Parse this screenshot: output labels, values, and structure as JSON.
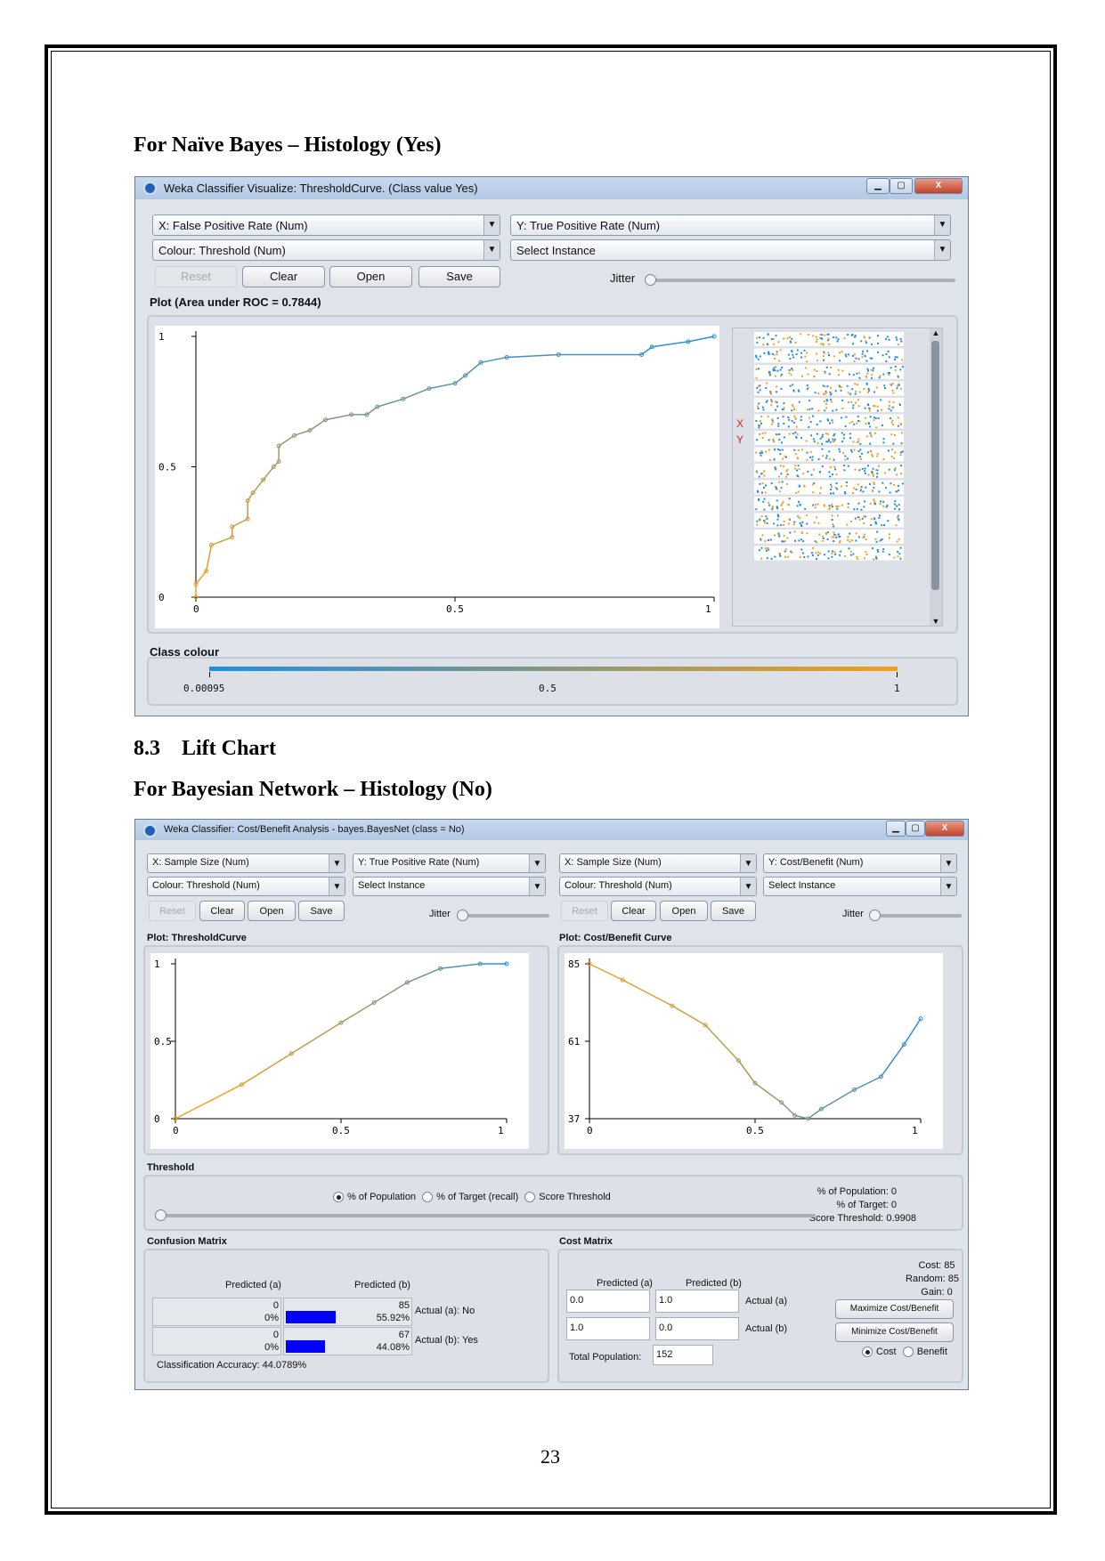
{
  "headings": {
    "h1": "For Naïve Bayes – Histology (Yes)",
    "section_num": "8.3",
    "section_title": "Lift Chart",
    "h2": "For Bayesian Network – Histology (No)"
  },
  "page_number": "23",
  "window1": {
    "title": "Weka Classifier Visualize: ThresholdCurve. (Class value Yes)",
    "x_combo": "X: False Positive Rate (Num)",
    "y_combo": "Y: True Positive Rate (Num)",
    "colour_combo": "Colour: Threshold (Num)",
    "select_instance": "Select Instance",
    "buttons": {
      "reset": "Reset",
      "clear": "Clear",
      "open": "Open",
      "save": "Save"
    },
    "jitter": "Jitter",
    "jitter_level": 0,
    "plot_label": "Plot (Area under ROC = 0.7844)",
    "side_x": "X",
    "side_y": "Y",
    "class_colour_label": "Class colour",
    "colour_ticks": [
      "0.00095",
      "0.5",
      "1"
    ],
    "colors": {
      "low": "#1f8fe0",
      "high": "#f0a020"
    }
  },
  "window2": {
    "title": "Weka Classifier: Cost/Benefit Analysis - bayes.BayesNet  (class = No)",
    "left": {
      "x_combo": "X: Sample Size (Num)",
      "y_combo": "Y: True Positive Rate (Num)",
      "colour_combo": "Colour: Threshold (Num)",
      "select_instance": "Select Instance",
      "plot_label": "Plot: ThresholdCurve"
    },
    "right": {
      "x_combo": "X: Sample Size (Num)",
      "y_combo": "Y: Cost/Benefit (Num)",
      "colour_combo": "Colour: Threshold (Num)",
      "select_instance": "Select Instance",
      "plot_label": "Plot: Cost/Benefit Curve"
    },
    "buttons": {
      "reset": "Reset",
      "clear": "Clear",
      "open": "Open",
      "save": "Save"
    },
    "jitter": "Jitter",
    "threshold": {
      "label": "Threshold",
      "options": [
        "% of Population",
        "% of Target (recall)",
        "Score Threshold"
      ],
      "selected": 0,
      "pop": "% of Population: 0",
      "target": "% of Target: 0",
      "score": "Score Threshold: 0.9908",
      "slider_level": 0
    },
    "confusion": {
      "label": "Confusion Matrix",
      "pred_a": "Predicted (a)",
      "pred_b": "Predicted (b)",
      "rows": [
        {
          "a_count": "0",
          "a_pct": "0%",
          "b_count": "85",
          "b_pct": "55.92%",
          "b_fill": 0.5592,
          "actual": "Actual (a): No"
        },
        {
          "a_count": "0",
          "a_pct": "0%",
          "b_count": "67",
          "b_pct": "44.08%",
          "b_fill": 0.4408,
          "actual": "Actual (b): Yes"
        }
      ],
      "accuracy": "Classification Accuracy:  44.0789%"
    },
    "cost": {
      "label": "Cost Matrix",
      "pred_a": "Predicted (a)",
      "pred_b": "Predicted (b)",
      "rows": [
        {
          "a": "0.0",
          "b": "1.0",
          "actual": "Actual (a)"
        },
        {
          "a": "1.0",
          "b": "0.0",
          "actual": "Actual (b)"
        }
      ],
      "total_label": "Total Population:",
      "total": "152",
      "cost": "Cost: 85",
      "random": "Random: 85",
      "gain": "Gain: 0",
      "maximize": "Maximize Cost/Benefit",
      "minimize": "Minimize Cost/Benefit",
      "radio": [
        "Cost",
        "Benefit"
      ],
      "selected": 0
    }
  },
  "chart_data": [
    {
      "type": "line",
      "title": "Plot (Area under ROC = 0.7844)",
      "xlim": [
        0,
        1
      ],
      "ylim": [
        0,
        1
      ],
      "xticks": [
        "0",
        "0.5",
        "1"
      ],
      "yticks": [
        "0",
        "0.5",
        "1"
      ],
      "x": [
        0,
        0,
        0.02,
        0.03,
        0.07,
        0.07,
        0.1,
        0.1,
        0.11,
        0.13,
        0.15,
        0.16,
        0.16,
        0.19,
        0.22,
        0.25,
        0.3,
        0.33,
        0.35,
        0.4,
        0.45,
        0.5,
        0.52,
        0.55,
        0.6,
        0.7,
        0.86,
        0.88,
        0.95,
        1
      ],
      "y": [
        0,
        0.05,
        0.1,
        0.2,
        0.23,
        0.27,
        0.3,
        0.37,
        0.4,
        0.45,
        0.5,
        0.52,
        0.58,
        0.62,
        0.64,
        0.68,
        0.7,
        0.7,
        0.73,
        0.76,
        0.8,
        0.82,
        0.85,
        0.9,
        0.92,
        0.93,
        0.93,
        0.96,
        0.98,
        1
      ]
    },
    {
      "type": "line",
      "title": "Plot: ThresholdCurve",
      "xlim": [
        0,
        1
      ],
      "ylim": [
        0,
        1
      ],
      "xticks": [
        "0",
        "0.5",
        "1"
      ],
      "yticks": [
        "0",
        "0.5",
        "1"
      ],
      "x": [
        0,
        0.2,
        0.35,
        0.5,
        0.6,
        0.7,
        0.8,
        0.92,
        1
      ],
      "y": [
        0,
        0.22,
        0.42,
        0.62,
        0.75,
        0.88,
        0.97,
        1,
        1
      ]
    },
    {
      "type": "line",
      "title": "Plot: Cost/Benefit Curve",
      "xlim": [
        0,
        1
      ],
      "ylim": [
        37,
        85
      ],
      "xticks": [
        "0",
        "0.5",
        "1"
      ],
      "yticks": [
        "37",
        "61",
        "85"
      ],
      "x": [
        0,
        0.1,
        0.25,
        0.35,
        0.45,
        0.5,
        0.58,
        0.62,
        0.66,
        0.7,
        0.8,
        0.88,
        0.95,
        1
      ],
      "y": [
        85,
        80,
        72,
        66,
        55,
        48,
        42,
        38,
        37,
        40,
        46,
        50,
        60,
        68
      ]
    }
  ]
}
